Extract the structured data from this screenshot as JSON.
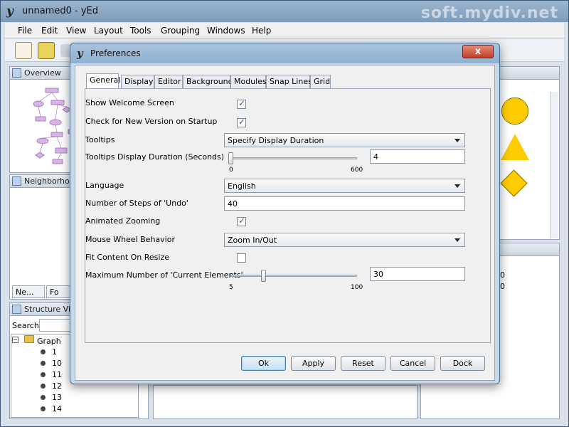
{
  "app": {
    "title": "unnamed0 - yEd",
    "logo": "y",
    "watermark": "soft.mydiv.net"
  },
  "menu": [
    "File",
    "Edit",
    "View",
    "Layout",
    "Tools",
    "Grouping",
    "Windows",
    "Help"
  ],
  "panels": {
    "overview_title": "Overview",
    "neighborhood_title": "Neighborhoo",
    "tabs": [
      "Ne...",
      "Fo"
    ],
    "structure_title": "Structure Vie",
    "search_label": "Search",
    "tree_root": "Graph",
    "tree_nodes": [
      "1",
      "10",
      "11",
      "12",
      "13",
      "14"
    ],
    "right_values": [
      "0",
      "0"
    ]
  },
  "dialog": {
    "title": "Preferences",
    "close_symbol": "x",
    "tabs": [
      "General",
      "Display",
      "Editor",
      "Background",
      "Modules",
      "Snap Lines",
      "Grid"
    ],
    "active_tab": "General",
    "fields": {
      "show_welcome": {
        "label": "Show Welcome Screen",
        "checked": true
      },
      "check_version": {
        "label": "Check for New Version on Startup",
        "checked": true
      },
      "tooltips": {
        "label": "Tooltips",
        "value": "Specify Display Duration"
      },
      "tooltip_duration": {
        "label": "Tooltips Display Duration (Seconds)",
        "min": "0",
        "max": "600",
        "value": "4",
        "fraction": 0.0
      },
      "language": {
        "label": "Language",
        "value": "English"
      },
      "undo_steps": {
        "label": "Number of Steps of 'Undo'",
        "value": "40"
      },
      "animated_zoom": {
        "label": "Animated Zooming",
        "checked": true
      },
      "mouse_wheel": {
        "label": "Mouse Wheel Behavior",
        "value": "Zoom In/Out"
      },
      "fit_content": {
        "label": "Fit Content On Resize",
        "checked": false
      },
      "max_current": {
        "label": "Maximum Number of 'Current Elements'",
        "min": "5",
        "max": "100",
        "value": "30",
        "fraction": 0.26
      }
    },
    "buttons": {
      "ok": "Ok",
      "apply": "Apply",
      "reset": "Reset",
      "cancel": "Cancel",
      "dock": "Dock"
    }
  },
  "colors": {
    "accent_yellow": "#ffcc00",
    "overview_node": "#c8a0d8"
  }
}
